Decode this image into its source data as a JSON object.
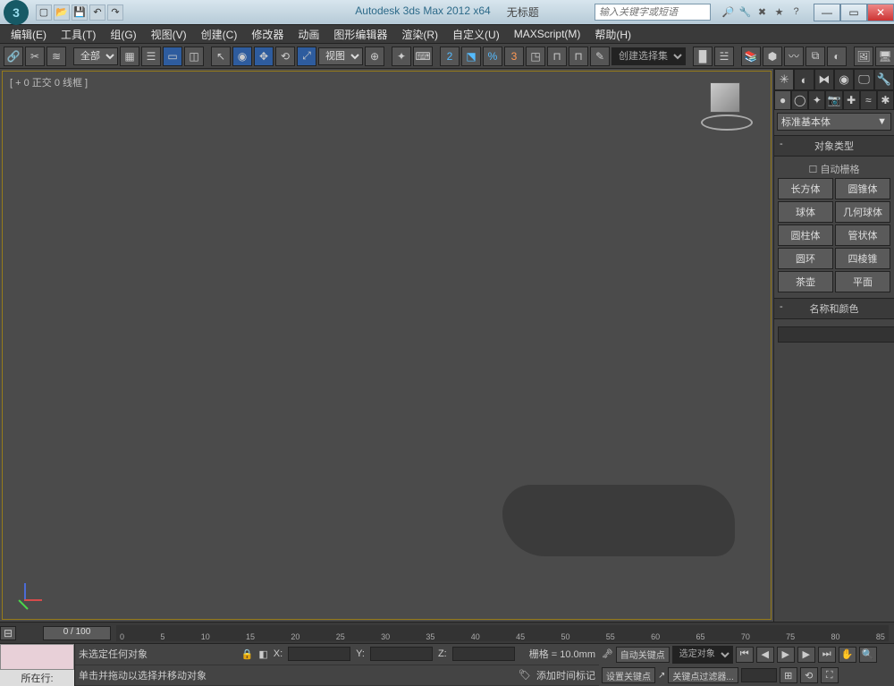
{
  "title": {
    "app": "Autodesk 3ds Max  2012  x64",
    "doc": "无标题"
  },
  "search": {
    "placeholder": "输入关键字或短语"
  },
  "menus": [
    "编辑(E)",
    "工具(T)",
    "组(G)",
    "视图(V)",
    "创建(C)",
    "修改器",
    "动画",
    "图形编辑器",
    "渲染(R)",
    "自定义(U)",
    "MAXScript(M)",
    "帮助(H)"
  ],
  "toolbar": {
    "layer_filter": "全部",
    "view_label": "视图",
    "named_sel": "创建选择集"
  },
  "viewport": {
    "label": "[ + 0 正交 0 线框 ]"
  },
  "panel": {
    "category": "标准基本体",
    "rollout_type": "对象类型",
    "autogrid": "自动栅格",
    "types": [
      "长方体",
      "圆锥体",
      "球体",
      "几何球体",
      "圆柱体",
      "管状体",
      "圆环",
      "四棱锥",
      "茶壶",
      "平面"
    ],
    "rollout_name": "名称和颜色"
  },
  "timeline": {
    "slider": "0 / 100",
    "ticks": [
      "0",
      "5",
      "10",
      "15",
      "20",
      "25",
      "30",
      "35",
      "40",
      "45",
      "50",
      "55",
      "60",
      "65",
      "70",
      "75",
      "80",
      "85"
    ]
  },
  "status": {
    "sel": "未选定任何对象",
    "hint": "单击并拖动以选择并移动对象",
    "x": "X:",
    "y": "Y:",
    "z": "Z:",
    "grid": "栅格 = 10.0mm",
    "addtag": "添加时间标记",
    "autokey": "自动关键点",
    "setkey": "设置关键点",
    "selectedobj": "选定对象",
    "keyfilter": "关键点过滤器...",
    "row_label": "所在行:"
  }
}
